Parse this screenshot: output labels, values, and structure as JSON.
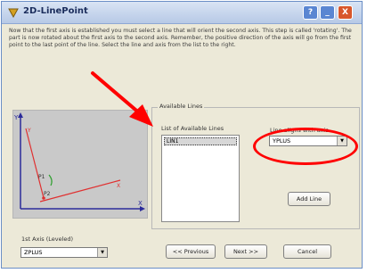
{
  "window": {
    "title": "2D-LinePoint",
    "help_glyph": "?",
    "minimize_glyph": "_",
    "close_glyph": "X"
  },
  "instructions": "Now that the first axis is established you must select a line that will orient the second axis. This step is called 'rotating'. The part is now rotated about the first axis to the second axis. Remember, the positive direction of the axis will go from the first point to the last point of the line. Select the line and axis from the list to the right.",
  "diagram": {
    "axis_y": "Y",
    "axis_x": "X",
    "label_y": "Y",
    "label_x": "X",
    "label_p1": "P1",
    "label_p2": "P2"
  },
  "available_lines": {
    "group_label": "Available Lines",
    "list_label": "List of Available Lines",
    "items": [
      "LIN1"
    ],
    "align_label": "Line aligns with axis",
    "align_value": "YPLUS",
    "add_line_label": "Add Line"
  },
  "first_axis": {
    "label": "1st Axis (Leveled)",
    "value": "ZPLUS"
  },
  "buttons": {
    "previous": "<< Previous",
    "next": "Next >>",
    "cancel": "Cancel"
  },
  "colors": {
    "annotation_red": "#ff0000",
    "diagram_bg": "#c9c9c9"
  }
}
